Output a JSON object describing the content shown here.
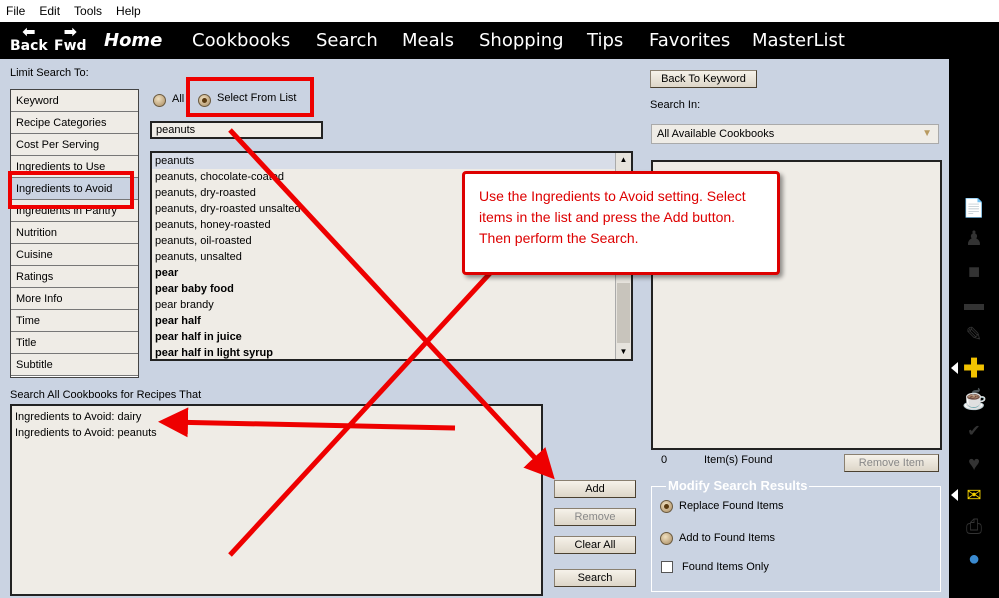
{
  "menu": [
    "File",
    "Edit",
    "Tools",
    "Help"
  ],
  "nav": {
    "back": "Back",
    "fwd": "Fwd",
    "items": [
      "Home",
      "Cookbooks",
      "Search",
      "Meals",
      "Shopping",
      "Tips",
      "Favorites",
      "MasterList"
    ]
  },
  "limit_label": "Limit Search To:",
  "limit_items": [
    "Keyword",
    "Recipe Categories",
    "Cost Per Serving",
    "Ingredients to Use",
    "Ingredients to Avoid",
    "Ingredients in Pantry",
    "Nutrition",
    "Cuisine",
    "Ratings",
    "More Info",
    "Time",
    "Title",
    "Subtitle"
  ],
  "radio_all": "All",
  "radio_select": "Select From List",
  "filter_value": "peanuts",
  "ingredients": [
    {
      "text": "peanuts",
      "bold": false
    },
    {
      "text": "peanuts, chocolate-coated",
      "bold": false
    },
    {
      "text": "peanuts, dry-roasted",
      "bold": false
    },
    {
      "text": "peanuts, dry-roasted unsalted",
      "bold": false
    },
    {
      "text": "peanuts, honey-roasted",
      "bold": false
    },
    {
      "text": "peanuts, oil-roasted",
      "bold": false
    },
    {
      "text": "peanuts, unsalted",
      "bold": false
    },
    {
      "text": "pear",
      "bold": true
    },
    {
      "text": "pear baby food",
      "bold": true
    },
    {
      "text": "pear brandy",
      "bold": false
    },
    {
      "text": "pear half",
      "bold": true
    },
    {
      "text": "pear half in juice",
      "bold": true
    },
    {
      "text": "pear half in light syrup",
      "bold": true
    }
  ],
  "criteria_label": "Search All Cookbooks for Recipes That",
  "criteria": [
    "Ingredients to Avoid: dairy",
    "Ingredients to Avoid: peanuts"
  ],
  "buttons": {
    "add": "Add",
    "remove": "Remove",
    "clear_all": "Clear All",
    "search": "Search",
    "back_to_keyword": "Back To Keyword",
    "remove_item": "Remove Item"
  },
  "search_in_label": "Search In:",
  "search_in_value": "All Available Cookbooks",
  "found_count": "0",
  "found_label": "Item(s) Found",
  "modify": {
    "title": "Modify Search Results",
    "replace": "Replace Found Items",
    "add_to": "Add to Found Items",
    "found_only": "Found Items Only"
  },
  "callout": "Use the Ingredients to Avoid setting. Select items in the list and press the Add button. Then perform the Search.",
  "sidebar_icons": [
    "new-recipe-icon",
    "chef-icon",
    "cookbook-icon",
    "card-icon",
    "pencil-icon",
    "add-icon",
    "cup-icon",
    "spellcheck-icon",
    "heart-icon",
    "mail-icon",
    "printer-icon",
    "globe-icon"
  ]
}
